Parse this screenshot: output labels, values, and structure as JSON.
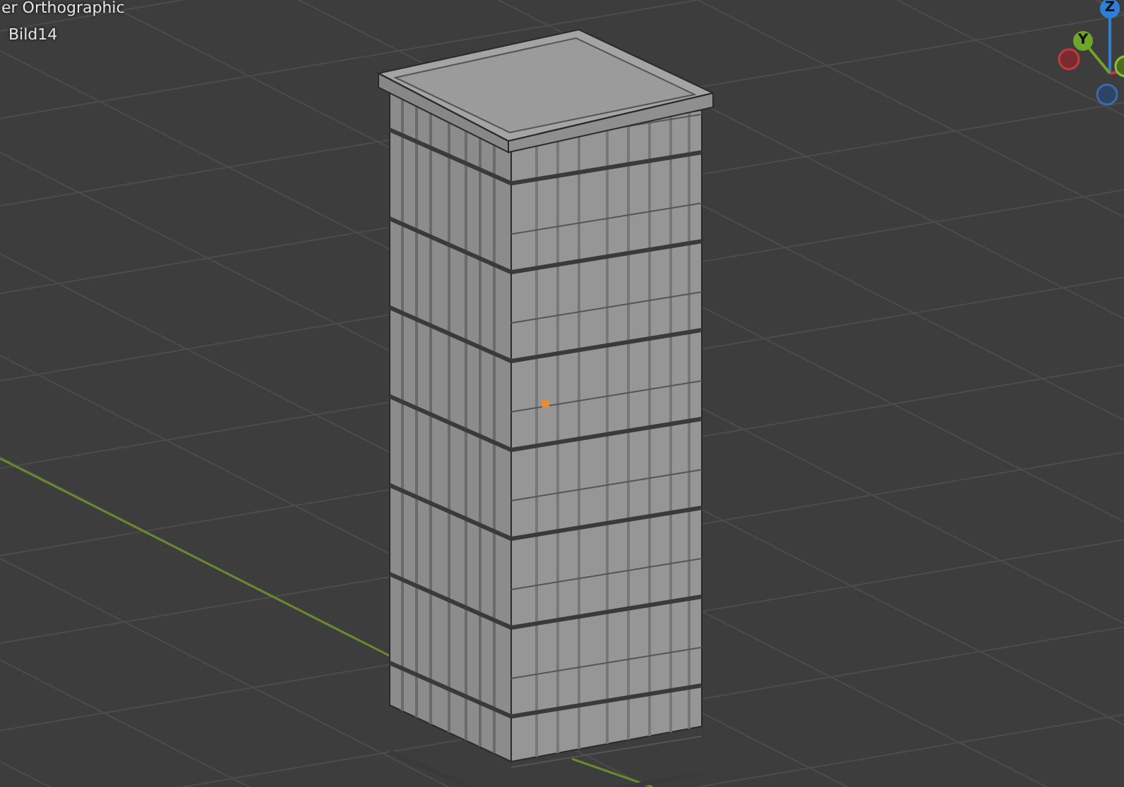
{
  "viewport": {
    "view_name": "er Orthographic",
    "object_name": "Bild14"
  },
  "gizmo": {
    "axes": [
      {
        "label": "Z",
        "color": "#2f7fd6"
      },
      {
        "label": "Y",
        "color": "#6ea52a"
      }
    ]
  }
}
